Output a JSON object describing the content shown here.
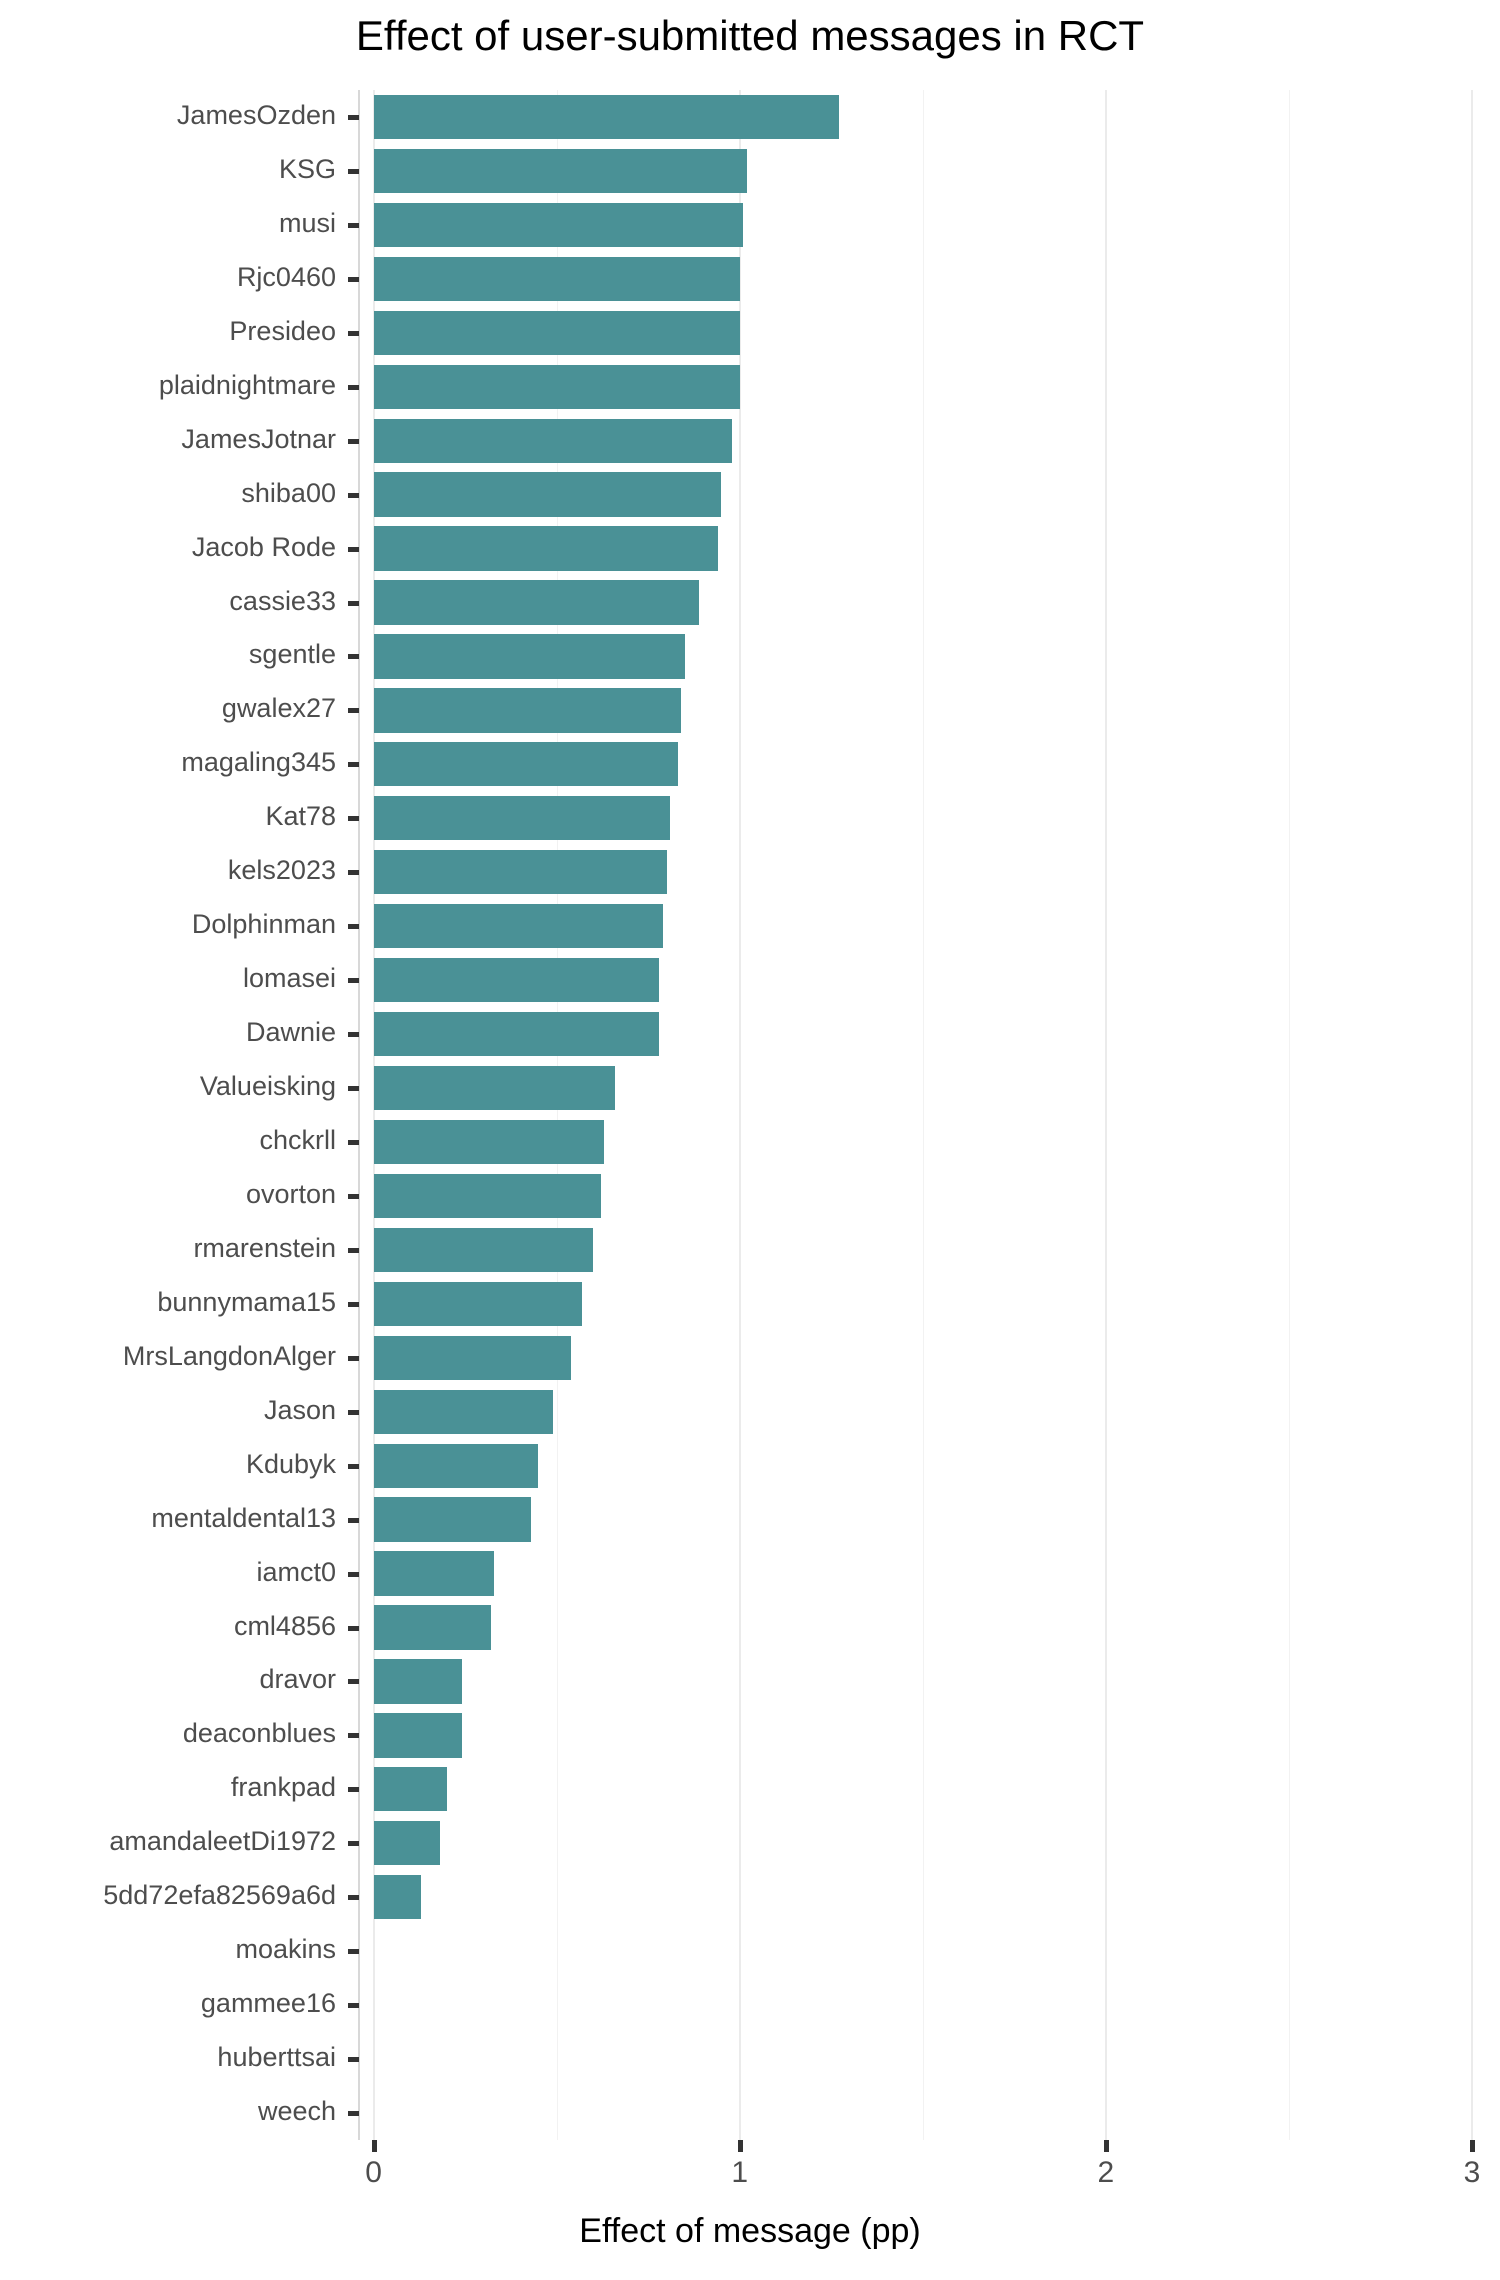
{
  "chart_data": {
    "type": "bar",
    "orientation": "horizontal",
    "title": "Effect of user-submitted messages in RCT",
    "xlabel": "Effect of message (pp)",
    "ylabel": "",
    "xlim": [
      -0.04,
      3.0
    ],
    "xticks": [
      0,
      1,
      2,
      3
    ],
    "xticklabels": [
      "0",
      "1",
      "2",
      "3"
    ],
    "minor_gridlines": [
      0.5,
      1.5,
      2.5
    ],
    "grid": "vertical-only",
    "legend": "none",
    "bar_color": "#4a9196",
    "panel_background": "#ffffff",
    "gridline_color": "#ebebeb",
    "categories": [
      "JamesOzden",
      "KSG",
      "musi",
      "Rjc0460",
      "Presideo",
      "plaidnightmare",
      "JamesJotnar",
      "shiba00",
      "Jacob Rode",
      "cassie33",
      "sgentle",
      "gwalex27",
      "magaling345",
      "Kat78",
      "kels2023",
      "Dolphinman",
      "lomasei",
      "Dawnie",
      "Valueisking",
      "chckrll",
      "ovorton",
      "rmarenstein",
      "bunnymama15",
      "MrsLangdonAlger",
      "Jason",
      "Kdubyk",
      "mentaldental13",
      "iamct0",
      "cml4856",
      "dravor",
      "deaconblues",
      "frankpad",
      "amandaleetDi1972",
      "5dd72efa82569a6d",
      "moakins",
      "gammee16",
      "huberttsai",
      "weech"
    ],
    "values": [
      1.27,
      1.02,
      1.01,
      1.0,
      1.0,
      1.0,
      0.98,
      0.95,
      0.94,
      0.89,
      0.85,
      0.84,
      0.83,
      0.81,
      0.8,
      0.79,
      0.78,
      0.78,
      0.66,
      0.63,
      0.62,
      0.6,
      0.57,
      0.54,
      0.49,
      0.45,
      0.43,
      0.33,
      0.32,
      0.24,
      0.24,
      0.2,
      0.18,
      0.13,
      0.0,
      0.0,
      0.0,
      0.0
    ]
  }
}
